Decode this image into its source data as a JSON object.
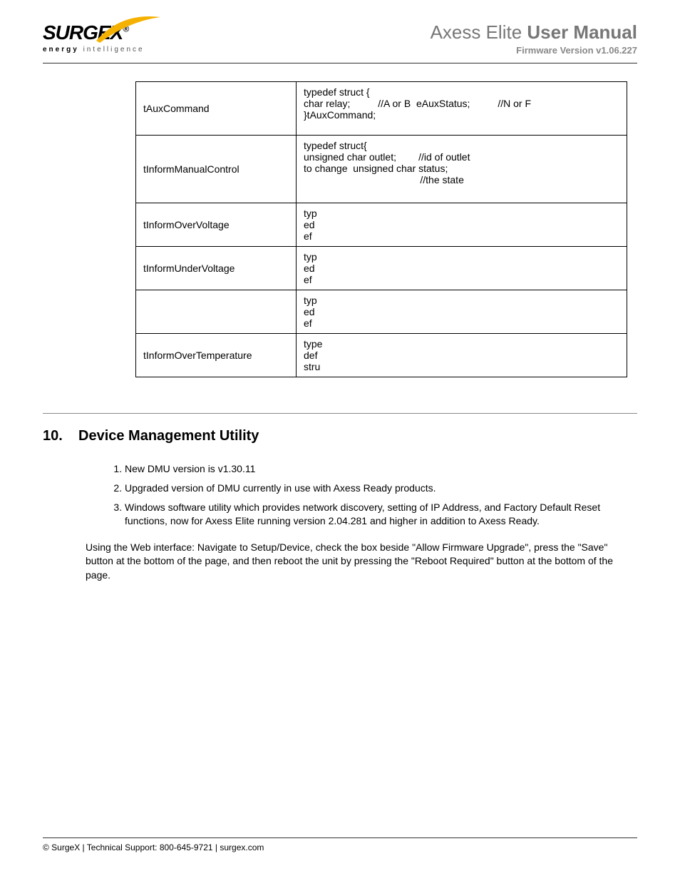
{
  "header": {
    "logo_text": "SURGEX",
    "logo_reg": "®",
    "logo_tag_bold": "energy",
    "logo_tag_rest": " intelligence",
    "title_light": "Axess Elite ",
    "title_bold": "User Manual",
    "sub": "Firmware Version v1.06.227"
  },
  "table": {
    "rows": [
      {
        "name": "tAuxCommand",
        "def": "typedef struct {\nchar relay;          //A or B  eAuxStatus;          //N or F\n}tAuxCommand;"
      },
      {
        "name": "tInformManualControl",
        "def": "typedef struct{\nunsigned char outlet;        //id of outlet\nto change  unsigned char status;\n                                          //the state"
      },
      {
        "name": "tInformOverVoltage",
        "def": "typ\ned\nef"
      },
      {
        "name": "tInformUnderVoltage",
        "def": "typ\ned\nef"
      },
      {
        "name": "",
        "def": "typ\ned\nef"
      },
      {
        "name": "tInformOverTemperature",
        "def": "type\ndef\nstru"
      }
    ]
  },
  "section": {
    "num": "10.",
    "title": "Device Management Utility",
    "items": [
      "New DMU version is  v1.30.11",
      "Upgraded version of DMU currently in use with Axess Ready products.",
      "Windows software utility which provides network discovery, setting of IP Address, and Factory Default Reset functions, now for Axess Elite running version 2.04.281 and higher in addition to Axess Ready."
    ],
    "para": "Using the Web interface: Navigate to Setup/Device, check the box beside \"Allow Firmware Upgrade\", press the \"Save\" button at the bottom of the page, and then reboot the unit by pressing the \"Reboot Required\" button at the bottom of the page."
  },
  "footer": "© SurgeX  |  Technical Support: 800-645-9721  |  surgex.com"
}
